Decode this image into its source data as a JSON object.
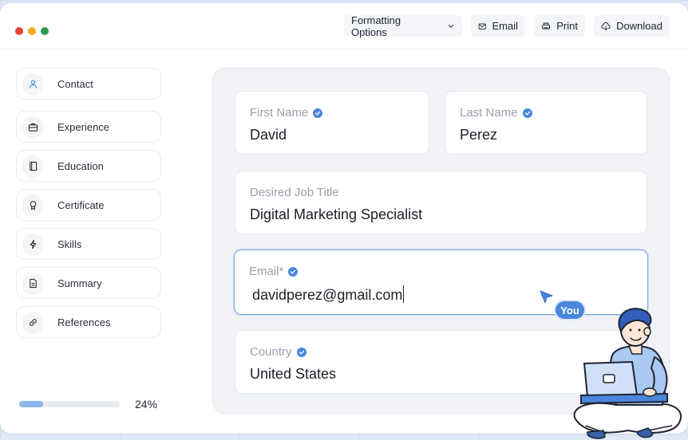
{
  "toolbar": {
    "formatting_label": "Formatting Options",
    "email_label": "Email",
    "print_label": "Print",
    "download_label": "Download"
  },
  "sidebar": {
    "items": [
      {
        "label": "Contact",
        "icon": "user-icon"
      },
      {
        "label": "Experience",
        "icon": "briefcase-icon"
      },
      {
        "label": "Education",
        "icon": "book-icon"
      },
      {
        "label": "Certificate",
        "icon": "award-icon"
      },
      {
        "label": "Skills",
        "icon": "lightning-icon"
      },
      {
        "label": "Summary",
        "icon": "document-icon"
      },
      {
        "label": "References",
        "icon": "link-icon"
      }
    ]
  },
  "progress": {
    "label": "24%",
    "value": 0.24
  },
  "form": {
    "first_name": {
      "label": "First Name",
      "value": "David"
    },
    "last_name": {
      "label": "Last Name",
      "value": "Perez"
    },
    "job_title": {
      "label": "Desired Job Title",
      "value": "Digital Marketing Specialist"
    },
    "email": {
      "label": "Email*",
      "value": "davidperez@gmail.com"
    },
    "country": {
      "label": "Country",
      "value": "United States"
    }
  },
  "cursor": {
    "badge": "You"
  },
  "colors": {
    "accent": "#4a86dc",
    "progress": "#8fb7ec",
    "dot_red": "#e5433a",
    "dot_yellow": "#f3ac1f",
    "dot_green": "#2c9a4f"
  }
}
